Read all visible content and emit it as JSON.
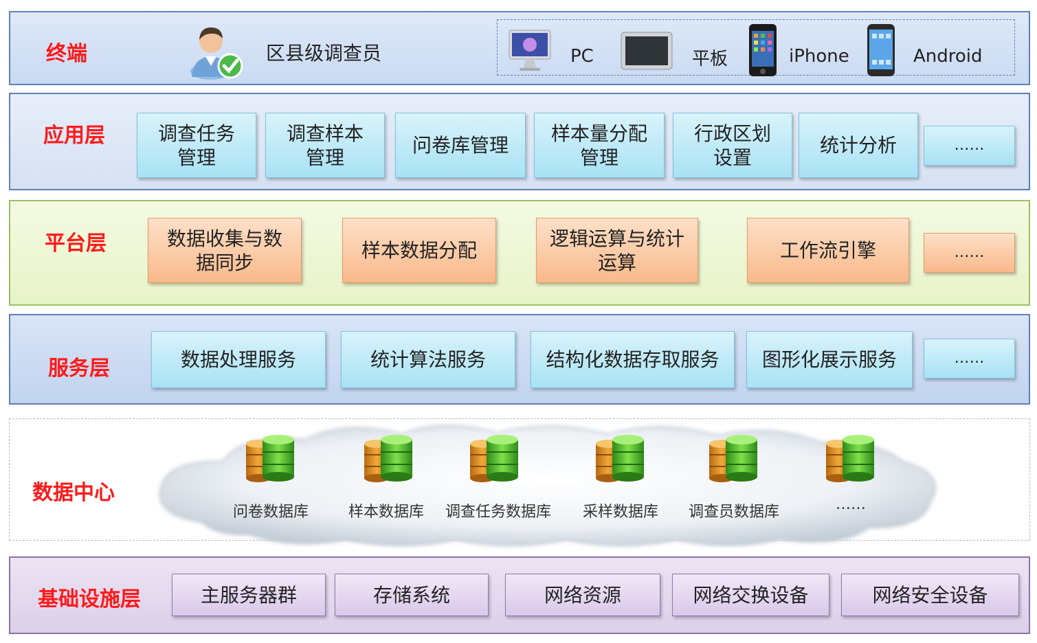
{
  "terminal": {
    "label": "终端",
    "user": "区县级调查员",
    "devices": [
      {
        "name": "PC",
        "icon": "imac-icon"
      },
      {
        "name": "平板",
        "icon": "tablet-icon"
      },
      {
        "name": "iPhone",
        "icon": "iphone-icon"
      },
      {
        "name": "Android",
        "icon": "android-phone-icon"
      }
    ]
  },
  "application": {
    "label": "应用层",
    "items": [
      "调查任务\n管理",
      "调查样本\n管理",
      "问卷库管理",
      "样本量分配\n管理",
      "行政区划\n设置",
      "统计分析",
      "……"
    ]
  },
  "platform": {
    "label": "平台层",
    "items": [
      "数据收集与数\n据同步",
      "样本数据分配",
      "逻辑运算与统计\n运算",
      "工作流引擎",
      "……"
    ]
  },
  "service": {
    "label": "服务层",
    "items": [
      "数据处理服务",
      "统计算法服务",
      "结构化数据存取服务",
      "图形化展示服务",
      "……"
    ]
  },
  "datacenter": {
    "label": "数据中心",
    "databases": [
      "问卷数据库",
      "样本数据库",
      "调查任务数据库",
      "采样数据库",
      "调查员数据库",
      "……"
    ]
  },
  "infrastructure": {
    "label": "基础设施层",
    "items": [
      "主服务器群",
      "存储系统",
      "网络资源",
      "网络交换设备",
      "网络安全设备"
    ]
  },
  "colors": {
    "label_red": "#ff1a1a",
    "terminal_bg": "#d6e3f5",
    "application_bg": "#dfe8f6",
    "platform_bg": "#eef7d6",
    "service_bg": "#c9d8f1",
    "infrastructure_bg": "#e6dcef"
  }
}
